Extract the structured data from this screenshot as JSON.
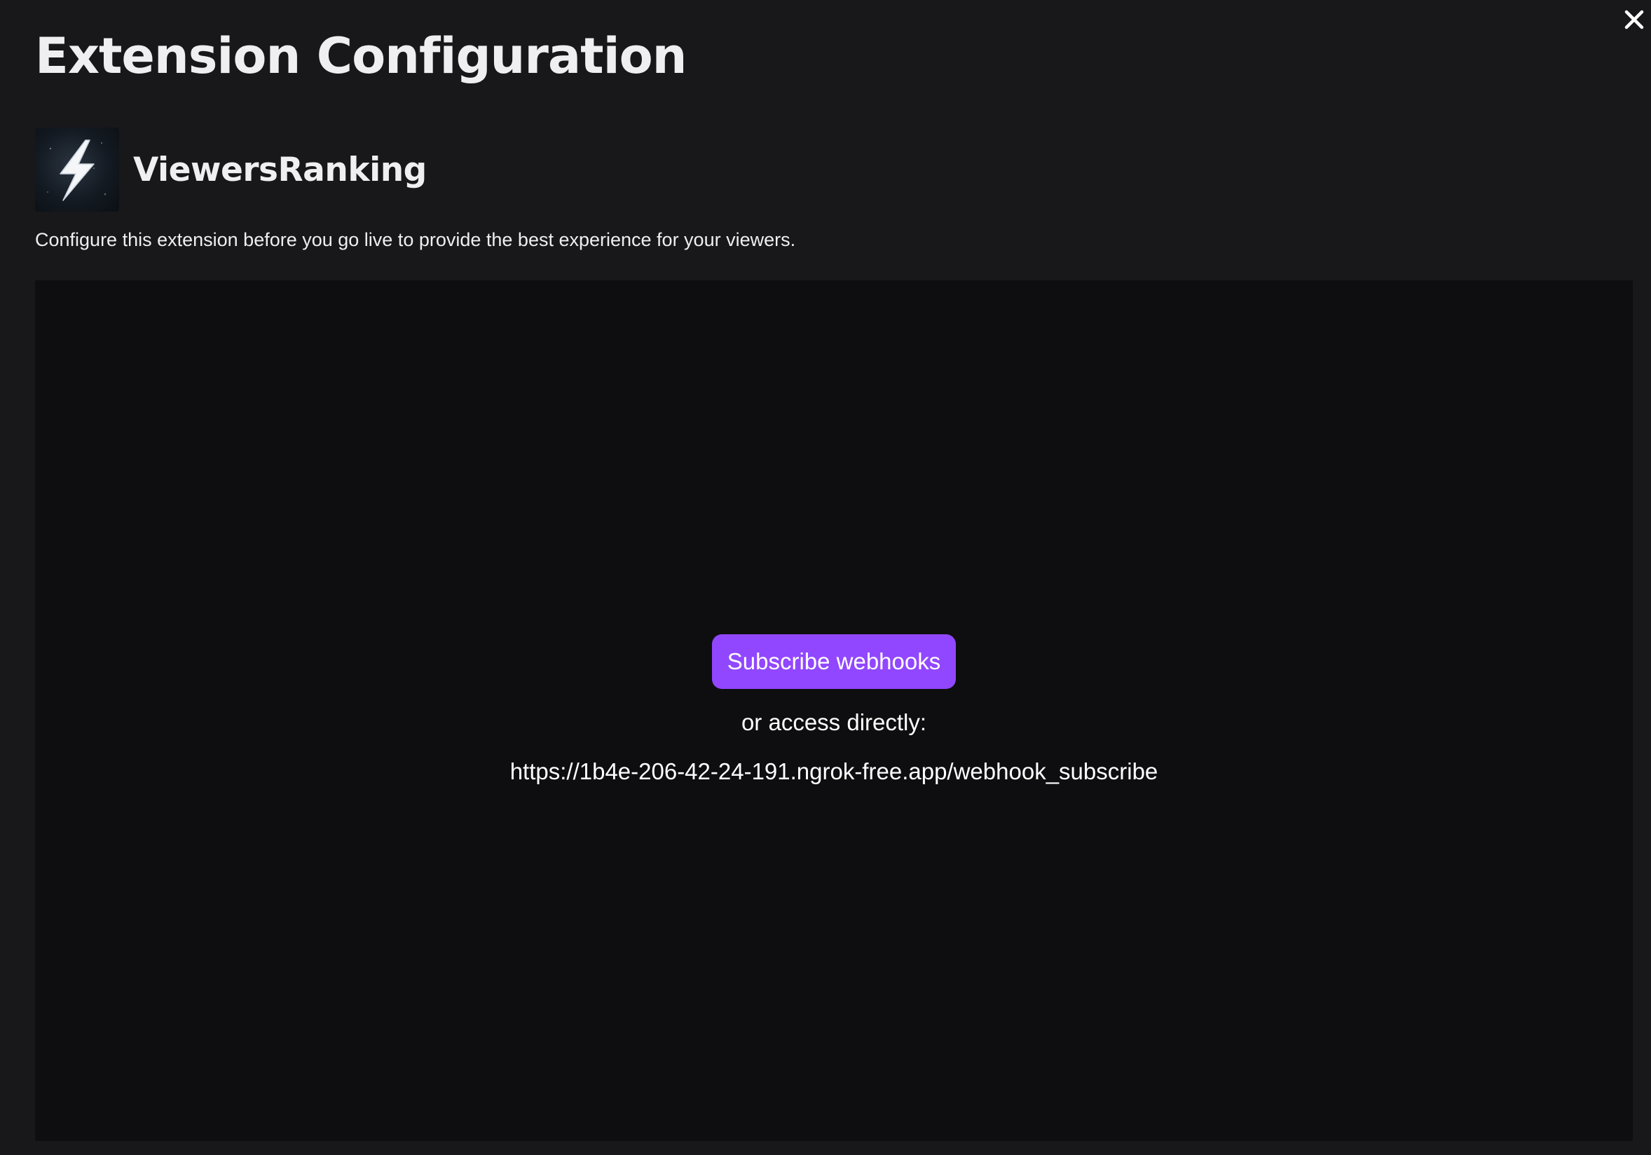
{
  "modal": {
    "title": "Extension Configuration",
    "close_icon": "close-icon"
  },
  "extension": {
    "name": "ViewersRanking",
    "logo_icon": "lightning-bolt-icon",
    "description": "Configure this extension before you go live to provide the best experience for your viewers."
  },
  "config_panel": {
    "subscribe_button_label": "Subscribe webhooks",
    "access_text": "or access directly:",
    "webhook_url": "https://1b4e-206-42-24-191.ngrok-free.app/webhook_subscribe"
  },
  "colors": {
    "page_background": "#18181b",
    "panel_background": "#0e0e10",
    "accent": "#9147ff",
    "text": "#efeff1"
  }
}
